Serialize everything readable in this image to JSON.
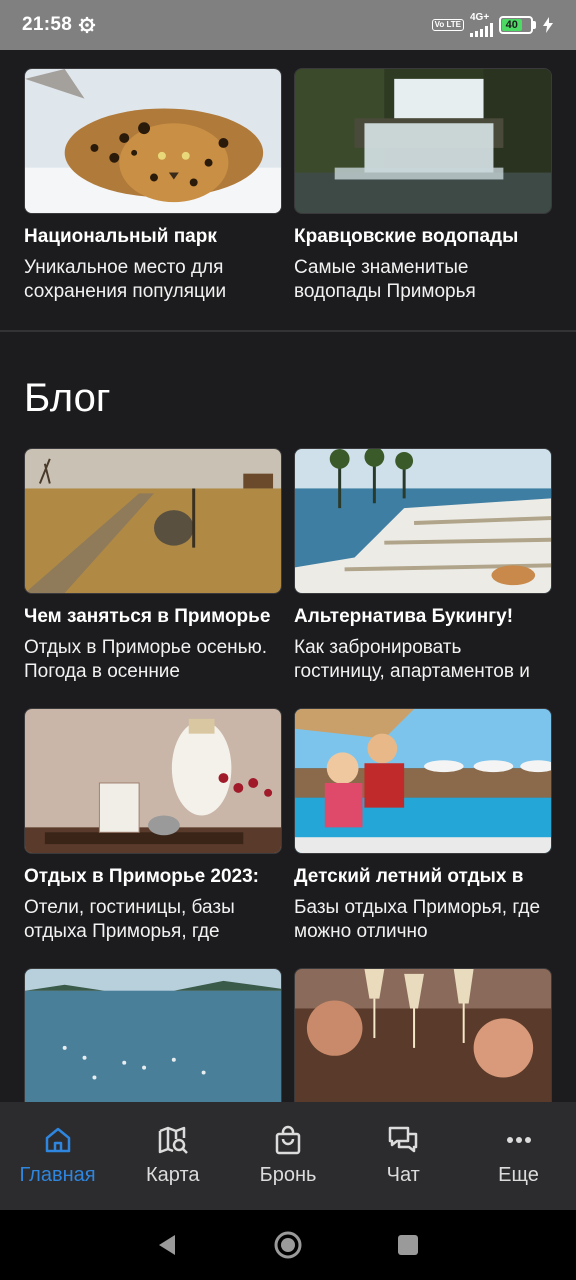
{
  "status_bar": {
    "time": "21:58",
    "network": "4G+",
    "volte": "Vo LTE",
    "battery_level": "40",
    "battery_color": "#4cd964"
  },
  "places": [
    {
      "title": "Национальный парк",
      "desc": "Уникальное место для сохранения популяции",
      "image": "leopard-photo"
    },
    {
      "title": "Кравцовские водопады",
      "desc": "Самые знаменитые водопады Приморья",
      "image": "waterfall-photo"
    }
  ],
  "blog": {
    "heading": "Блог",
    "posts": [
      {
        "title": "Чем заняться в Приморье",
        "desc": "Отдых в Приморье осенью. Погода в осенние",
        "image": "autumn-road-photo"
      },
      {
        "title": "Альтернатива Букингу!",
        "desc": "Как забронировать гостиницу, апартаментов и",
        "image": "pool-loungers-photo"
      },
      {
        "title": "Отдых в Приморье 2023:",
        "desc": "Отели, гостиницы, базы отдыха Приморья, где",
        "image": "hotel-reception-photo"
      },
      {
        "title": "Детский летний отдых в",
        "desc": "Базы отдыха Приморья, где можно отлично",
        "image": "kids-pool-photo"
      },
      {
        "title": "",
        "desc": "",
        "image": "sea-birds-photo"
      },
      {
        "title": "",
        "desc": "",
        "image": "party-toast-photo"
      }
    ]
  },
  "bottom_nav": {
    "active_color": "#2e86de",
    "items": [
      {
        "label": "Главная",
        "icon": "home-icon"
      },
      {
        "label": "Карта",
        "icon": "map-search-icon"
      },
      {
        "label": "Бронь",
        "icon": "shopping-bag-icon"
      },
      {
        "label": "Чат",
        "icon": "chat-icon"
      },
      {
        "label": "Еще",
        "icon": "more-icon"
      }
    ]
  }
}
